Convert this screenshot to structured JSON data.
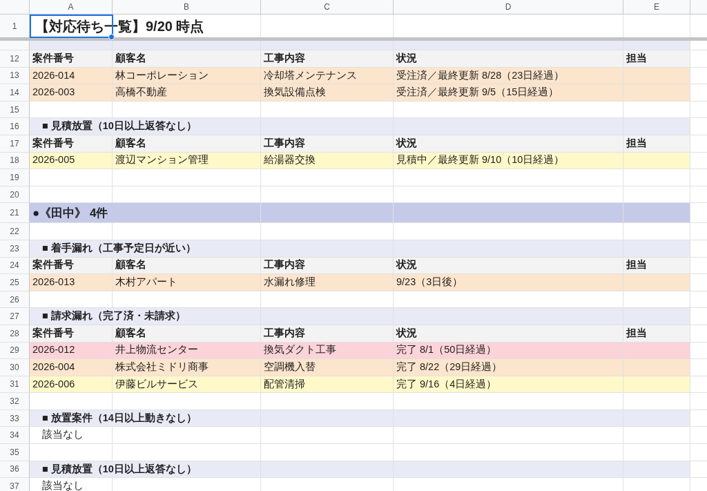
{
  "columns": [
    "A",
    "B",
    "C",
    "D",
    "E"
  ],
  "rows": [
    {
      "number": "1",
      "kind": "title",
      "text": "【対応待ち一覧】9/20 時点",
      "selected": true
    },
    {
      "kind": "hidden"
    },
    {
      "number": "12",
      "kind": "header",
      "cells": [
        "案件番号",
        "顧客名",
        "工事内容",
        "状況",
        "担当"
      ]
    },
    {
      "number": "13",
      "kind": "item",
      "color": "#fce5cd",
      "cells": [
        "2026-014",
        "林コーポレーション",
        "冷却塔メンテナンス",
        "受注済／最終更新 8/28（23日経過）"
      ]
    },
    {
      "number": "14",
      "kind": "item",
      "color": "#fce5cd",
      "cells": [
        "2026-003",
        "高橋不動産",
        "換気設備点検",
        "受注済／最終更新 9/5（15日経過）"
      ]
    },
    {
      "number": "15",
      "kind": "empty"
    },
    {
      "number": "16",
      "kind": "section",
      "text": "■ 見積放置（10日以上返答なし）"
    },
    {
      "number": "17",
      "kind": "header",
      "cells": [
        "案件番号",
        "顧客名",
        "工事内容",
        "状況",
        "担当"
      ]
    },
    {
      "number": "18",
      "kind": "item",
      "color": "#fff8c9",
      "cells": [
        "2026-005",
        "渡辺マンション管理",
        "給湯器交換",
        "見積中／最終更新 9/10（10日経過）"
      ]
    },
    {
      "number": "19",
      "kind": "empty"
    },
    {
      "number": "20",
      "kind": "empty"
    },
    {
      "number": "21",
      "kind": "person",
      "text": "●《田中》 4件"
    },
    {
      "number": "22",
      "kind": "empty"
    },
    {
      "number": "23",
      "kind": "section",
      "text": "■ 着手漏れ（工事予定日が近い）"
    },
    {
      "number": "24",
      "kind": "header",
      "cells": [
        "案件番号",
        "顧客名",
        "工事内容",
        "状況",
        "担当"
      ]
    },
    {
      "number": "25",
      "kind": "item",
      "color": "#fce5cd",
      "cells": [
        "2026-013",
        "木村アパート",
        "水漏れ修理",
        "9/23（3日後）"
      ]
    },
    {
      "number": "26",
      "kind": "empty"
    },
    {
      "number": "27",
      "kind": "section",
      "text": "■ 請求漏れ（完了済・未請求）"
    },
    {
      "number": "28",
      "kind": "header",
      "cells": [
        "案件番号",
        "顧客名",
        "工事内容",
        "状況",
        "担当"
      ]
    },
    {
      "number": "29",
      "kind": "item",
      "color": "#fbd3d8",
      "cells": [
        "2026-012",
        "井上物流センター",
        "換気ダクト工事",
        "完了 8/1（50日経過）"
      ]
    },
    {
      "number": "30",
      "kind": "item",
      "color": "#fce5cd",
      "cells": [
        "2026-004",
        "株式会社ミドリ商事",
        "空調機入替",
        "完了 8/22（29日経過）"
      ]
    },
    {
      "number": "31",
      "kind": "item",
      "color": "#fff8c9",
      "cells": [
        "2026-006",
        "伊藤ビルサービス",
        "配管清掃",
        "完了 9/16（4日経過）"
      ]
    },
    {
      "number": "32",
      "kind": "empty"
    },
    {
      "number": "33",
      "kind": "section",
      "text": "■ 放置案件（14日以上動きなし）"
    },
    {
      "number": "34",
      "kind": "note",
      "text": "該当なし"
    },
    {
      "number": "35",
      "kind": "empty"
    },
    {
      "number": "36",
      "kind": "section",
      "text": "■ 見積放置（10日以上返答なし）"
    },
    {
      "number": "37",
      "kind": "note",
      "text": "該当なし"
    }
  ]
}
